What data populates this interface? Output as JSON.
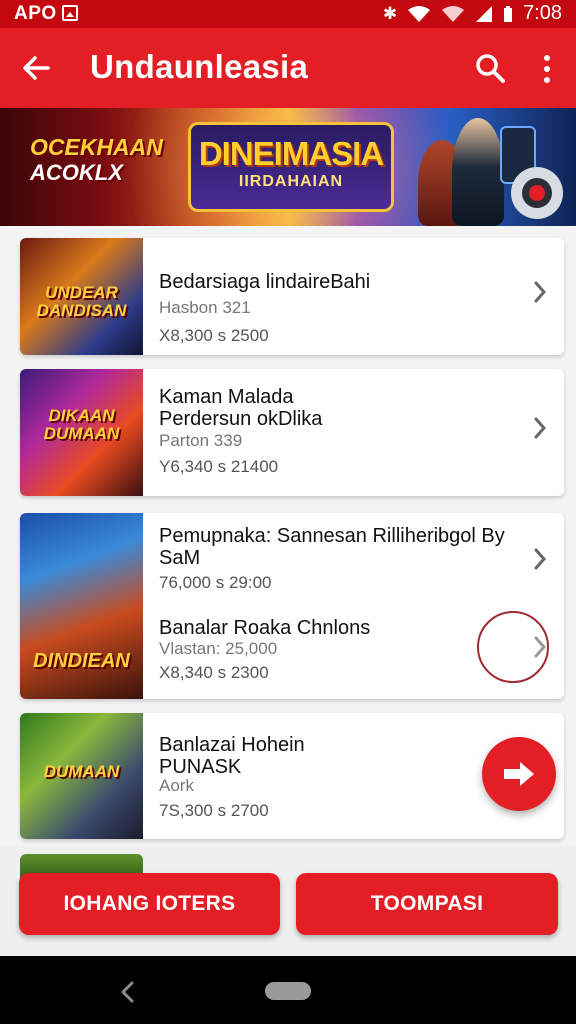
{
  "status": {
    "left": "APO",
    "time": "7:08"
  },
  "appbar": {
    "title": "Undaunleasia"
  },
  "banner": {
    "left_line1": "OCEKHAAN",
    "left_line2": "ACOKLX",
    "logo_line1": "DINEIMASIA",
    "logo_line2": "IIRDAHAIAN"
  },
  "items": [
    {
      "thumb_text": "UNDEAR DANDISAN",
      "title": "Bedarsiaga lindaireBahi",
      "sub": "Hasbon 321",
      "meta": "X8,300 s 2500"
    },
    {
      "thumb_text": "DIKAAN DUMAAN",
      "title": "Kaman Malada Perdersun okDlika",
      "sub": "Parton 339",
      "meta": "Y6,340 s 21400"
    },
    {
      "thumb_text": "DINDIEAN",
      "title": "Pemupnaka: Sannesan Rilliheribgol By SaM",
      "meta": "76,000 s 29:00",
      "title2": "Banalar Roaka Chnlons",
      "sub2": "Vlastan: 25,000",
      "meta2": "X8,340 s 2300"
    },
    {
      "thumb_text": "DUMAAN",
      "title": "Banlazai Hohein PUNASK",
      "sub": "Aork",
      "meta": "7S,300 s 2700"
    }
  ],
  "buttons": {
    "left": "IOHANG IOTERS",
    "right": "TOOMPASI"
  },
  "colors": {
    "primary": "#e31e24",
    "status": "#c4080f"
  },
  "icons": [
    "back-arrow-icon",
    "search-icon",
    "more-vert-icon",
    "chevron-right-icon",
    "forward-arrow-icon"
  ]
}
